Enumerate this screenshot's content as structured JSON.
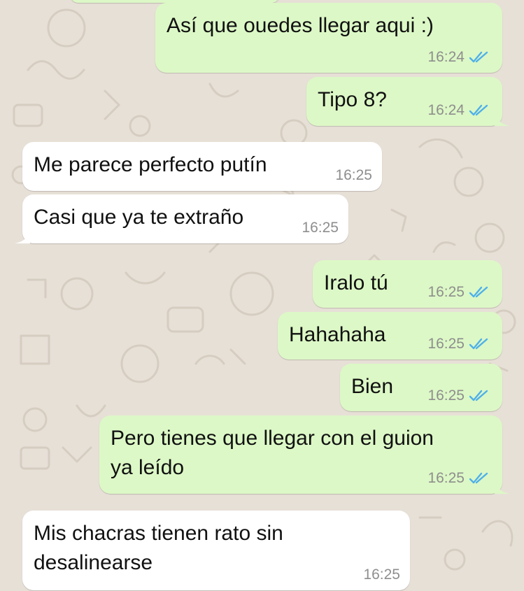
{
  "colors": {
    "outgoing_bubble": "#dcf8c6",
    "incoming_bubble": "#ffffff",
    "chat_background": "#e7e0d7",
    "read_ticks": "#4fb0ea",
    "timestamp": "#8e8e8e"
  },
  "icons": {
    "read_receipt": "double-check-icon"
  },
  "messages": [
    {
      "direction": "outgoing",
      "lines": [
        "Así que ouedes llegar aqui :)"
      ],
      "time": "16:24",
      "read": true
    },
    {
      "direction": "outgoing",
      "lines": [
        "Tipo 8?"
      ],
      "time": "16:24",
      "read": true
    },
    {
      "direction": "incoming",
      "lines": [
        "Me parece perfecto putín"
      ],
      "time": "16:25"
    },
    {
      "direction": "incoming",
      "lines": [
        "Casi que ya te extraño"
      ],
      "time": "16:25"
    },
    {
      "direction": "outgoing",
      "lines": [
        "Iralo tú"
      ],
      "time": "16:25",
      "read": true
    },
    {
      "direction": "outgoing",
      "lines": [
        "Hahahaha"
      ],
      "time": "16:25",
      "read": true
    },
    {
      "direction": "outgoing",
      "lines": [
        "Bien"
      ],
      "time": "16:25",
      "read": true
    },
    {
      "direction": "outgoing",
      "lines": [
        "Pero tienes que llegar con el guion",
        "ya leído"
      ],
      "time": "16:25",
      "read": true
    },
    {
      "direction": "incoming",
      "lines": [
        "Mis chacras tienen rato sin",
        "desalinearse"
      ],
      "time": "16:25"
    }
  ]
}
